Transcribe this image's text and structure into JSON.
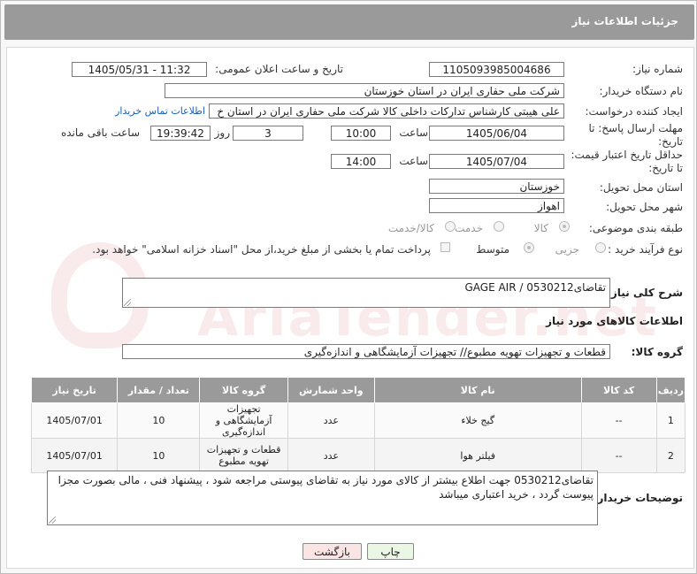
{
  "header": {
    "title": "جزئیات اطلاعات نیاز"
  },
  "fields": {
    "need_number_label": "شماره نیاز:",
    "need_number": "1105093985004686",
    "announce_label": "تاریخ و ساعت اعلان عمومی:",
    "announce_value": "1405/05/31 - 11:32",
    "buyer_org_label": "نام دستگاه خریدار:",
    "buyer_org": "شرکت ملی حفاری ایران در استان خوزستان",
    "creator_label": "ایجاد کننده درخواست:",
    "creator": "علی هیبتی کارشناس تدارکات داخلی کالا شرکت ملی حفاری ایران در استان خ",
    "contact_link": "اطلاعات تماس خریدار",
    "deadline_label_1": "مهلت ارسال پاسخ: تا",
    "deadline_label_2": "تاریخ:",
    "deadline_date": "1405/06/04",
    "time_label": "ساعت",
    "deadline_time": "10:00",
    "days_value": "3",
    "days_label": "روز و",
    "remaining_time": "19:39:42",
    "remaining_label": "ساعت باقی مانده",
    "validity_label_1": "حداقل تاریخ اعتبار قیمت:",
    "validity_label_2": "تا تاریخ:",
    "validity_date": "1405/07/04",
    "validity_time": "14:00",
    "province_label": "استان محل تحویل:",
    "province": "خوزستان",
    "city_label": "شهر محل تحویل:",
    "city": "اهواز",
    "category_label": "طبقه بندی موضوعی:",
    "category_options": [
      "کالا",
      "خدمت",
      "کالا/خدمت"
    ],
    "process_label": "نوع فرآیند خرید :",
    "process_options": [
      "جزیی",
      "متوسط"
    ],
    "payment_note": "پرداخت تمام یا بخشی از مبلغ خرید،از محل \"اسناد خزانه اسلامی\" خواهد بود."
  },
  "description": {
    "label": "شرح کلی نیاز:",
    "value": "تقاضای0530212 / GAGE AIR"
  },
  "goods": {
    "section_title": "اطلاعات کالاهای مورد نیاز",
    "group_label": "گروه کالا:",
    "group_value": "قطعات و تجهیزات تهویه مطبوع// تجهیزات آزمایشگاهی و اندازه‌گیری",
    "columns": [
      "ردیف",
      "کد کالا",
      "نام کالا",
      "واحد شمارش",
      "گروه کالا",
      "تعداد / مقدار",
      "تاریخ نیاز"
    ],
    "rows": [
      {
        "index": "1",
        "code": "--",
        "name": "گیج خلاء",
        "unit": "عدد",
        "group": "تجهیزات آزمایشگاهی و اندازه‌گیری",
        "qty": "10",
        "date": "1405/07/01"
      },
      {
        "index": "2",
        "code": "--",
        "name": "فیلتر هوا",
        "unit": "عدد",
        "group": "قطعات و تجهیزات تهویه مطبوع",
        "qty": "10",
        "date": "1405/07/01"
      }
    ]
  },
  "buyer_notes": {
    "label": "توضیحات خریدار:",
    "value": "تقاضای0530212 جهت اطلاع بیشتر از کالای مورد نیاز به تقاضای پیوستی مراجعه شود ، پیشنهاد فنی ، مالی بصورت مجزا پیوست گردد ، خرید اعتباری میباشد"
  },
  "buttons": {
    "print": "چاپ",
    "back": "بازگشت"
  },
  "watermark": "AriaTender.net",
  "colors": {
    "header_bg": "#9a9a9a",
    "print_bg": "#e9f7e4",
    "back_bg": "#fbe4e4",
    "link": "#1a5fb4"
  }
}
